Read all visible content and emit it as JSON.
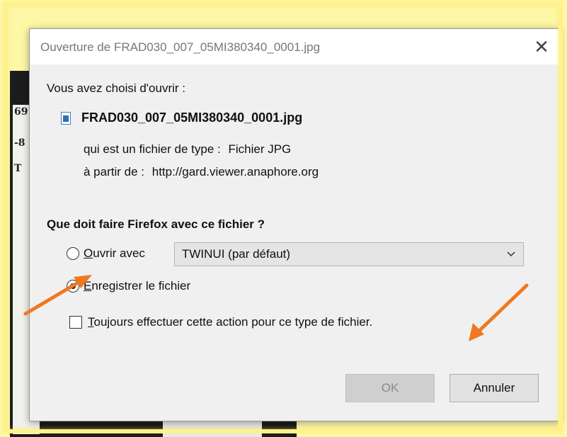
{
  "dialog": {
    "title": "Ouverture de FRAD030_007_05MI380340_0001.jpg",
    "close_label": "✕",
    "intro": "Vous avez choisi d'ouvrir :",
    "file_name": "FRAD030_007_05MI380340_0001.jpg",
    "file_type_label": "qui est un fichier de type :",
    "file_type_value": "Fichier JPG",
    "source_label": "à partir de :",
    "source_value": "http://gard.viewer.anaphore.org",
    "question": "Que doit faire Firefox avec ce fichier ?",
    "open_with": {
      "mnemonic": "O",
      "label_rest": "uvrir avec",
      "checked": false,
      "selected_app": "TWINUI (par défaut)"
    },
    "save_file": {
      "mnemonic": "E",
      "label_rest": "nregistrer le fichier",
      "checked": true
    },
    "always_do": {
      "mnemonic": "T",
      "label_rest": "oujours effectuer cette action pour ce type de fichier.",
      "checked": false
    },
    "buttons": {
      "ok": "OK",
      "cancel": "Annuler"
    }
  },
  "colors": {
    "highlight_frame": "#fff28a",
    "annotation_arrow": "#f07820",
    "dialog_bg": "#f0f0f0"
  }
}
